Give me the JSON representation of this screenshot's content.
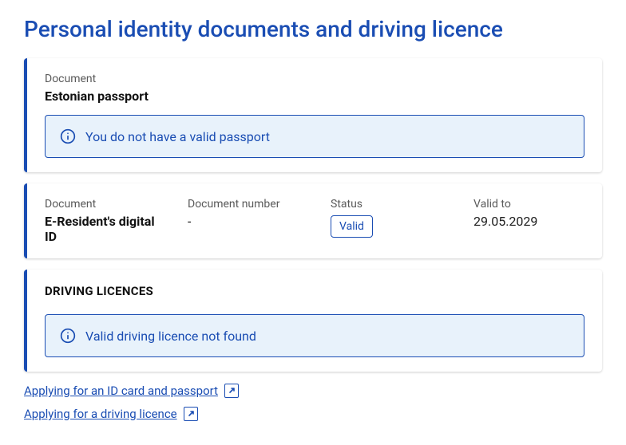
{
  "page": {
    "title": "Personal identity documents and driving licence"
  },
  "cards": {
    "passport": {
      "label": "Document",
      "name": "Estonian passport",
      "notice": "You do not have a valid passport"
    },
    "eresident": {
      "doc_label": "Document",
      "doc_name": "E-Resident's digital ID",
      "number_label": "Document number",
      "number_value": "-",
      "status_label": "Status",
      "status_value": "Valid",
      "valid_to_label": "Valid to",
      "valid_to_value": "29.05.2029"
    },
    "driving": {
      "section_title": "DRIVING LICENCES",
      "notice": "Valid driving licence not found"
    }
  },
  "links": {
    "id_passport": "Applying for an ID card and passport",
    "driving_licence": "Applying for a driving licence"
  }
}
